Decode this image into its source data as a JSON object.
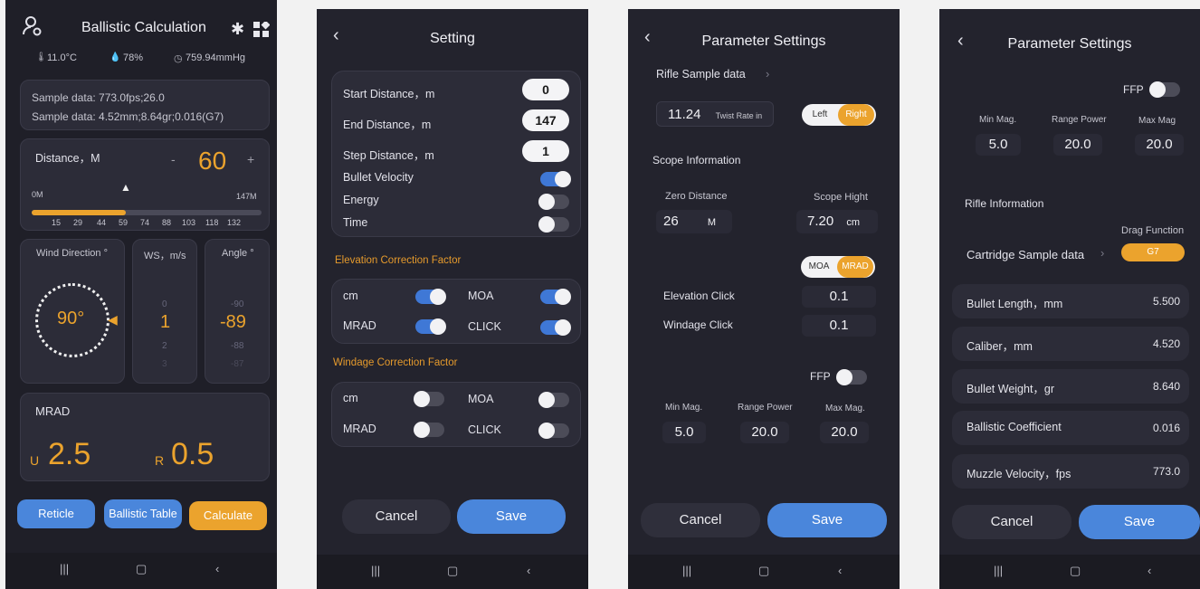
{
  "screen1": {
    "title": "Ballistic Calculation",
    "temperature": "11.0°C",
    "humidity": "78%",
    "pressure": "759.94mmHg",
    "sample_line1": "Sample data: 773.0fps;26.0",
    "sample_line2": "Sample data: 4.52mm;8.64gr;0.016(G7)",
    "distance_label": "Distance，M",
    "distance_minus": "-",
    "distance_value": "60",
    "distance_plus": "+",
    "scale_min": "0M",
    "scale_max": "147M",
    "scale_ticks": [
      "15",
      "29",
      "44",
      "59",
      "74",
      "88",
      "103",
      "118",
      "132"
    ],
    "wind_label": "Wind Direction °",
    "wind_value": "90°",
    "ws_label": "WS，m/s",
    "ws_above": "0",
    "ws_value": "1",
    "ws_below1": "2",
    "ws_below2": "3",
    "angle_label": "Angle °",
    "angle_above": "-90",
    "angle_value": "-89",
    "angle_below1": "-88",
    "angle_below2": "-87",
    "mrad_label": "MRAD",
    "u_prefix": "U",
    "u_value": "2.5",
    "r_prefix": "R",
    "r_value": "0.5",
    "btn_reticle": "Reticle",
    "btn_table": "Ballistic Table",
    "btn_calc": "Calculate"
  },
  "screen2": {
    "title": "Setting",
    "start_label": "Start Distance，m",
    "start_value": "0",
    "end_label": "End Distance，m",
    "end_value": "147",
    "step_label": "Step Distance，m",
    "step_value": "1",
    "velocity_label": "Bullet Velocity",
    "energy_label": "Energy",
    "time_label": "Time",
    "elev_header": "Elevation Correction Factor",
    "wind_header": "Windage Correction Factor",
    "cm": "cm",
    "moa": "MOA",
    "mrad": "MRAD",
    "click": "CLICK",
    "cancel": "Cancel",
    "save": "Save"
  },
  "screen3": {
    "title": "Parameter Settings",
    "rifle_sample": "Rifle Sample data",
    "twist_value": "11.24",
    "twist_label": "Twist Rate in",
    "left": "Left",
    "right": "Right",
    "scope_info": "Scope Information",
    "zero_label": "Zero Distance",
    "zero_value": "26",
    "zero_unit": "M",
    "height_label": "Scope Hight",
    "height_value": "7.20",
    "height_unit": "cm",
    "moa": "MOA",
    "mrad": "MRAD",
    "elev_click": "Elevation Click",
    "elev_click_value": "0.1",
    "wind_click": "Windage Click",
    "wind_click_value": "0.1",
    "ffp": "FFP",
    "min_mag_label": "Min Mag.",
    "min_mag": "5.0",
    "range_power_label": "Range Power",
    "range_power": "20.0",
    "max_mag_label": "Max Mag.",
    "max_mag": "20.0",
    "cancel": "Cancel",
    "save": "Save"
  },
  "screen4": {
    "title": "Parameter Settings",
    "ffp": "FFP",
    "min_mag_label": "Min Mag.",
    "min_mag": "5.0",
    "range_power_label": "Range Power",
    "range_power": "20.0",
    "max_mag_label": "Max Mag",
    "max_mag": "20.0",
    "rifle_info": "Rifle Information",
    "drag_label": "Drag Function",
    "cartridge": "Cartridge Sample data",
    "drag_value": "G7",
    "rows": [
      {
        "k": "Bullet Length，mm",
        "v": "5.500"
      },
      {
        "k": "Caliber，mm",
        "v": "4.520"
      },
      {
        "k": "Bullet Weight，gr",
        "v": "8.640"
      },
      {
        "k": "Ballistic Coefficient",
        "v": "0.016"
      },
      {
        "k": "Muzzle Velocity，fps",
        "v": "773.0"
      }
    ],
    "cancel": "Cancel",
    "save": "Save"
  },
  "colors": {
    "accent_orange": "#eba32d",
    "accent_blue": "#4a86db",
    "background": "#23232d"
  },
  "icons": [
    "user-gear-icon",
    "bluetooth-icon",
    "grid-icon",
    "thermometer-icon",
    "humidity-icon",
    "pressure-icon",
    "back-icon",
    "recent-apps-icon",
    "home-icon",
    "nav-back-icon"
  ]
}
